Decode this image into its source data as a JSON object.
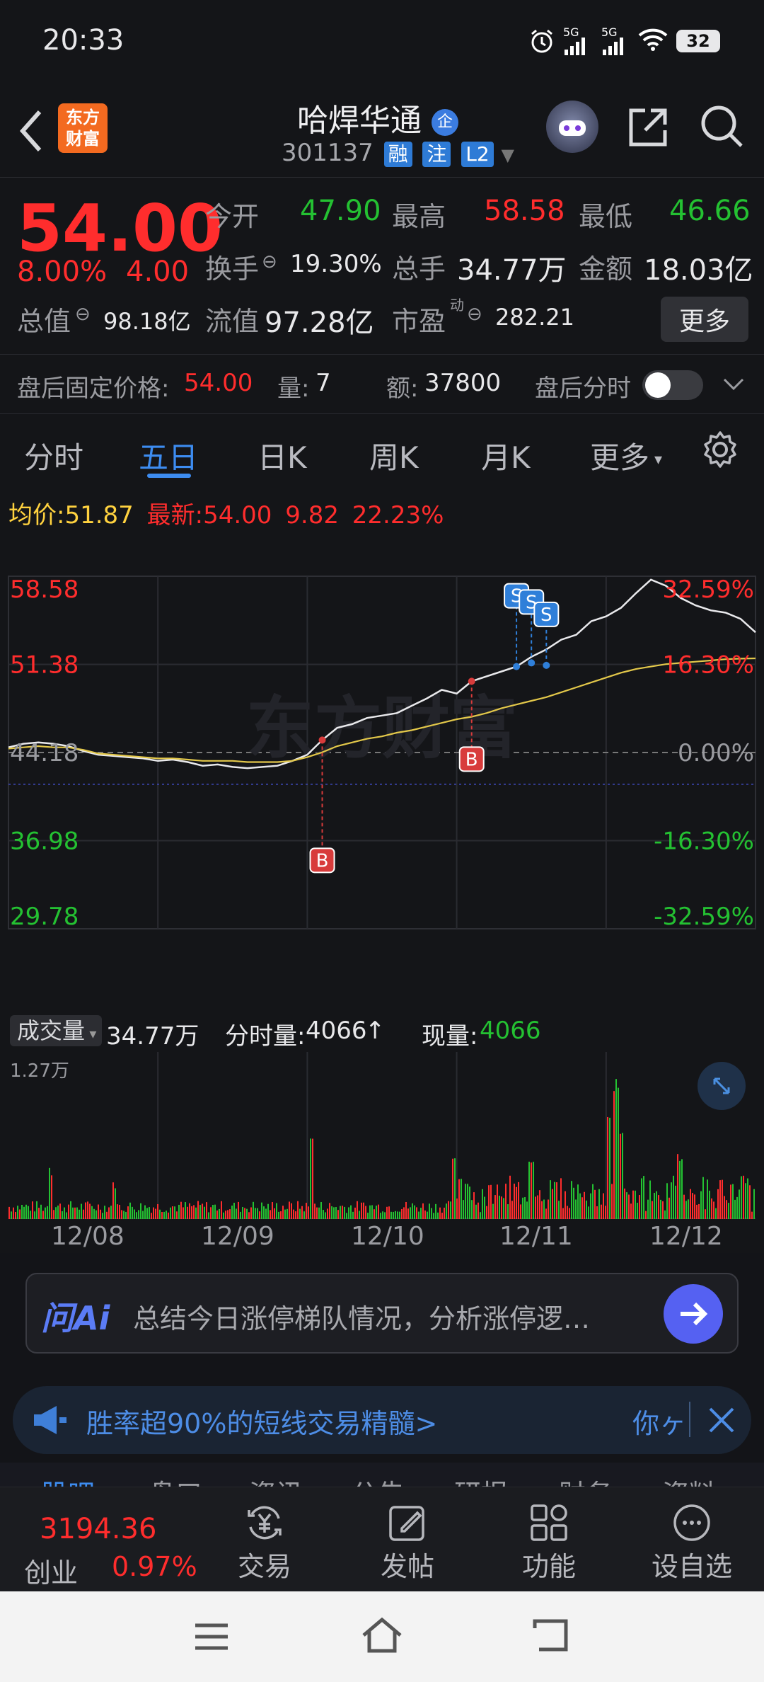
{
  "status_bar": {
    "time": "20:33",
    "battery": "32",
    "net1": "5G",
    "net2": "5G"
  },
  "header": {
    "logo_line1": "东方",
    "logo_line2": "财富",
    "stock_name": "哈焊华通",
    "name_badge": "企",
    "stock_code": "301137",
    "tags": [
      "融",
      "注",
      "L2"
    ]
  },
  "quote": {
    "price": "54.00",
    "change_pct": "8.00%",
    "change": "4.00",
    "open_label": "今开",
    "open": "47.90",
    "high_label": "最高",
    "high": "58.58",
    "low_label": "最低",
    "low": "46.66",
    "turnover_label": "换手",
    "turnover": "19.30%",
    "volume_label": "总手",
    "volume": "34.77万",
    "amount_label": "金额",
    "amount": "18.03亿",
    "mktcap_label": "总值",
    "mktcap": "98.18亿",
    "float_label": "流值",
    "float": "97.28亿",
    "pe_label": "市盈",
    "pe_sup": "动",
    "pe": "282.21",
    "more": "更多"
  },
  "after_hours": {
    "price_label": "盘后固定价格:",
    "price": "54.00",
    "vol_label": "量:",
    "vol": "7",
    "amt_label": "额:",
    "amt": "37800",
    "toggle_label": "盘后分时"
  },
  "tabs": [
    "分时",
    "五日",
    "日K",
    "周K",
    "月K",
    "更多"
  ],
  "active_tab": "五日",
  "chart_info": {
    "avg_label": "均价:",
    "avg": "51.87",
    "last_label": "最新:",
    "last": "54.00",
    "chg": "9.82",
    "chg_pct": "22.23%"
  },
  "chart_data": {
    "type": "line",
    "y_left_ticks": [
      "58.58",
      "51.38",
      "44.18",
      "36.98",
      "29.78"
    ],
    "y_right_ticks": [
      "32.59%",
      "16.30%",
      "0.00%",
      "-16.30%",
      "-32.59%"
    ],
    "ylim": [
      29.78,
      58.58
    ],
    "x_labels": [
      "12/08",
      "12/09",
      "12/10",
      "12/11",
      "12/12"
    ],
    "series": [
      {
        "values": [
          44.6,
          44.9,
          45.0,
          44.9,
          44.7,
          44.3,
          44.0,
          43.9,
          43.8,
          43.7,
          43.5,
          43.6,
          43.4,
          43.1,
          43.2,
          43.0,
          42.9,
          43.0,
          43.1,
          43.5,
          44.0,
          45.2,
          46.2,
          46.5,
          47.0,
          47.2,
          47.4,
          48.0,
          48.6,
          49.3,
          49.0,
          50.0,
          50.4,
          50.8,
          51.2,
          52.0,
          52.6,
          53.4,
          53.8,
          54.9,
          55.3,
          56.0,
          57.2,
          58.3,
          57.8,
          56.8,
          56.2,
          55.8,
          55.6,
          55.1,
          54.0
        ]
      },
      {
        "values": [
          44.5,
          44.6,
          44.7,
          44.6,
          44.6,
          44.4,
          44.1,
          44.0,
          43.9,
          43.8,
          43.7,
          43.7,
          43.6,
          43.5,
          43.5,
          43.5,
          43.4,
          43.4,
          43.4,
          43.5,
          43.8,
          44.2,
          44.7,
          45.0,
          45.3,
          45.5,
          45.8,
          46.0,
          46.3,
          46.6,
          46.9,
          47.1,
          47.4,
          47.8,
          48.1,
          48.4,
          48.7,
          49.1,
          49.5,
          49.9,
          50.3,
          50.7,
          51.0,
          51.2,
          51.4,
          51.5,
          51.6,
          51.7,
          51.8,
          51.85,
          51.87
        ]
      }
    ],
    "trade_marks": [
      {
        "type": "B",
        "x_index": 21,
        "value": 45.2
      },
      {
        "type": "B",
        "x_index": 31,
        "value": 50.0
      },
      {
        "type": "S",
        "x_index": 34,
        "value": 51.2
      },
      {
        "type": "S",
        "x_index": 35,
        "value": 51.5
      },
      {
        "type": "S",
        "x_index": 36,
        "value": 51.3
      }
    ],
    "volume_label": "成交量",
    "volume_total": "34.77万",
    "tick_vol_label": "分时量:",
    "tick_vol": "4066",
    "tick_vol_arrow": "↑",
    "now_vol_label": "现量:",
    "now_vol": "4066",
    "volume_max": "1.27万",
    "watermark": "东方财富"
  },
  "ai": {
    "brand": "问Ai",
    "prompt": "总结今日涨停梯队情况，分析涨停逻…"
  },
  "banner": {
    "text": "胜率超90%的短线交易精髓>",
    "right": "你ヶ"
  },
  "partial_tabs": [
    "股吧",
    "盘口",
    "资讯",
    "公告",
    "研报",
    "财务",
    "资料"
  ],
  "bottom_nav": {
    "index_value": "3194.36",
    "index_name": "创业",
    "index_pct": "0.97%",
    "items": [
      "交易",
      "发帖",
      "功能",
      "设自选"
    ]
  },
  "colors": {
    "up": "#ff2d2d",
    "down": "#24c132",
    "avg_line": "#e3c84a",
    "bg": "#141518"
  }
}
